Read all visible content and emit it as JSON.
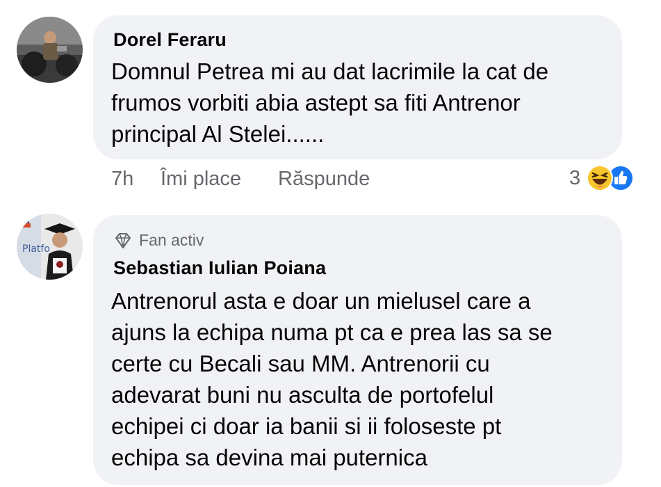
{
  "comments": [
    {
      "author": "Dorel Feraru",
      "lines": [
        "Domnul Petrea mi au dat lacrimile la cat de",
        "frumos vorbiti abia astept sa fiti Antrenor",
        "principal Al Stelei......"
      ],
      "time": "7h",
      "like_label": "Îmi place",
      "reply_label": "Răspunde",
      "reaction_count": "3",
      "reaction_icons": [
        "haha-icon",
        "like-icon"
      ]
    },
    {
      "badge_icon": "diamond-icon",
      "badge_label": "Fan activ",
      "author": "Sebastian Iulian Poiana",
      "lines": [
        "Antrenorul asta e doar un mielusel care a",
        "ajuns la echipa numa pt ca e prea las sa se",
        "certe cu Becali sau MM. Antrenorii cu",
        "adevarat buni nu asculta de portofelul",
        "echipei ci doar ia banii si ii foloseste pt",
        "echipa sa devina mai puternica"
      ]
    }
  ],
  "avatar_text": "Platfo",
  "colors": {
    "bubble": "#f0f2f5",
    "text": "#050505",
    "secondary": "#65676b",
    "like_blue": "#1877f2",
    "haha_yellow": "#f7c52c"
  }
}
